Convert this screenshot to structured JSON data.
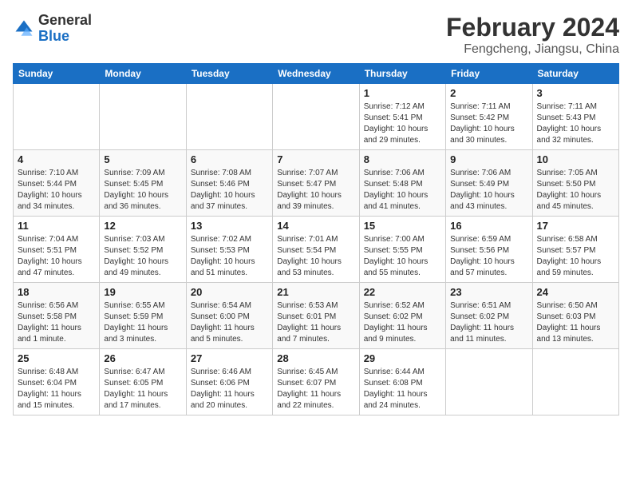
{
  "logo": {
    "general": "General",
    "blue": "Blue"
  },
  "title": {
    "main": "February 2024",
    "sub": "Fengcheng, Jiangsu, China"
  },
  "weekdays": [
    "Sunday",
    "Monday",
    "Tuesday",
    "Wednesday",
    "Thursday",
    "Friday",
    "Saturday"
  ],
  "weeks": [
    [
      {
        "day": "",
        "info": ""
      },
      {
        "day": "",
        "info": ""
      },
      {
        "day": "",
        "info": ""
      },
      {
        "day": "",
        "info": ""
      },
      {
        "day": "1",
        "info": "Sunrise: 7:12 AM\nSunset: 5:41 PM\nDaylight: 10 hours\nand 29 minutes."
      },
      {
        "day": "2",
        "info": "Sunrise: 7:11 AM\nSunset: 5:42 PM\nDaylight: 10 hours\nand 30 minutes."
      },
      {
        "day": "3",
        "info": "Sunrise: 7:11 AM\nSunset: 5:43 PM\nDaylight: 10 hours\nand 32 minutes."
      }
    ],
    [
      {
        "day": "4",
        "info": "Sunrise: 7:10 AM\nSunset: 5:44 PM\nDaylight: 10 hours\nand 34 minutes."
      },
      {
        "day": "5",
        "info": "Sunrise: 7:09 AM\nSunset: 5:45 PM\nDaylight: 10 hours\nand 36 minutes."
      },
      {
        "day": "6",
        "info": "Sunrise: 7:08 AM\nSunset: 5:46 PM\nDaylight: 10 hours\nand 37 minutes."
      },
      {
        "day": "7",
        "info": "Sunrise: 7:07 AM\nSunset: 5:47 PM\nDaylight: 10 hours\nand 39 minutes."
      },
      {
        "day": "8",
        "info": "Sunrise: 7:06 AM\nSunset: 5:48 PM\nDaylight: 10 hours\nand 41 minutes."
      },
      {
        "day": "9",
        "info": "Sunrise: 7:06 AM\nSunset: 5:49 PM\nDaylight: 10 hours\nand 43 minutes."
      },
      {
        "day": "10",
        "info": "Sunrise: 7:05 AM\nSunset: 5:50 PM\nDaylight: 10 hours\nand 45 minutes."
      }
    ],
    [
      {
        "day": "11",
        "info": "Sunrise: 7:04 AM\nSunset: 5:51 PM\nDaylight: 10 hours\nand 47 minutes."
      },
      {
        "day": "12",
        "info": "Sunrise: 7:03 AM\nSunset: 5:52 PM\nDaylight: 10 hours\nand 49 minutes."
      },
      {
        "day": "13",
        "info": "Sunrise: 7:02 AM\nSunset: 5:53 PM\nDaylight: 10 hours\nand 51 minutes."
      },
      {
        "day": "14",
        "info": "Sunrise: 7:01 AM\nSunset: 5:54 PM\nDaylight: 10 hours\nand 53 minutes."
      },
      {
        "day": "15",
        "info": "Sunrise: 7:00 AM\nSunset: 5:55 PM\nDaylight: 10 hours\nand 55 minutes."
      },
      {
        "day": "16",
        "info": "Sunrise: 6:59 AM\nSunset: 5:56 PM\nDaylight: 10 hours\nand 57 minutes."
      },
      {
        "day": "17",
        "info": "Sunrise: 6:58 AM\nSunset: 5:57 PM\nDaylight: 10 hours\nand 59 minutes."
      }
    ],
    [
      {
        "day": "18",
        "info": "Sunrise: 6:56 AM\nSunset: 5:58 PM\nDaylight: 11 hours\nand 1 minute."
      },
      {
        "day": "19",
        "info": "Sunrise: 6:55 AM\nSunset: 5:59 PM\nDaylight: 11 hours\nand 3 minutes."
      },
      {
        "day": "20",
        "info": "Sunrise: 6:54 AM\nSunset: 6:00 PM\nDaylight: 11 hours\nand 5 minutes."
      },
      {
        "day": "21",
        "info": "Sunrise: 6:53 AM\nSunset: 6:01 PM\nDaylight: 11 hours\nand 7 minutes."
      },
      {
        "day": "22",
        "info": "Sunrise: 6:52 AM\nSunset: 6:02 PM\nDaylight: 11 hours\nand 9 minutes."
      },
      {
        "day": "23",
        "info": "Sunrise: 6:51 AM\nSunset: 6:02 PM\nDaylight: 11 hours\nand 11 minutes."
      },
      {
        "day": "24",
        "info": "Sunrise: 6:50 AM\nSunset: 6:03 PM\nDaylight: 11 hours\nand 13 minutes."
      }
    ],
    [
      {
        "day": "25",
        "info": "Sunrise: 6:48 AM\nSunset: 6:04 PM\nDaylight: 11 hours\nand 15 minutes."
      },
      {
        "day": "26",
        "info": "Sunrise: 6:47 AM\nSunset: 6:05 PM\nDaylight: 11 hours\nand 17 minutes."
      },
      {
        "day": "27",
        "info": "Sunrise: 6:46 AM\nSunset: 6:06 PM\nDaylight: 11 hours\nand 20 minutes."
      },
      {
        "day": "28",
        "info": "Sunrise: 6:45 AM\nSunset: 6:07 PM\nDaylight: 11 hours\nand 22 minutes."
      },
      {
        "day": "29",
        "info": "Sunrise: 6:44 AM\nSunset: 6:08 PM\nDaylight: 11 hours\nand 24 minutes."
      },
      {
        "day": "",
        "info": ""
      },
      {
        "day": "",
        "info": ""
      }
    ]
  ]
}
